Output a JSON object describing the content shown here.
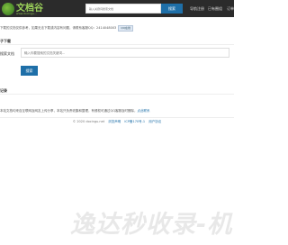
{
  "header": {
    "logo_text": "文档谷",
    "logo_sub": "www.docingu...",
    "search_placeholder": "输入关键词搜索文档",
    "search_button": "搜索",
    "nav": [
      "导航注册",
      "已有圈组",
      "订单"
    ]
  },
  "notice": {
    "text": "下载的文档仅供参考，如果无法下载或内容有问题，请联系客服QQ：2414048003",
    "badge": "QQ在线"
  },
  "download_section": {
    "title": "子下载",
    "field_label": "搜索文档",
    "field_placeholder": "输入你要搜索的文档关键词...",
    "submit_label": "搜索"
  },
  "record_section": {
    "title": "记录",
    "empty_text": "本站文档均来自互联网及网友上传分享，本站只负责收集和整理，有侵权可通过QQ客服及时删除，",
    "link_text": "点此联系"
  },
  "footer": {
    "copyright": "© 2020 docingu.net",
    "link1": "浏览声明",
    "link2": "ICP备170号-1",
    "link3": "用户协议"
  },
  "banner": {
    "text": "逸达秒收录-机"
  }
}
